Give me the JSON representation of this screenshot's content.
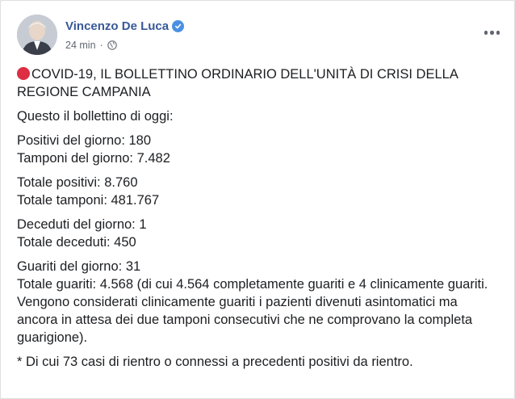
{
  "post": {
    "author": "Vincenzo De Luca",
    "verified": true,
    "time": "24 min",
    "dot_sep": "·",
    "audience_icon": "globe-icon",
    "more_icon": "more-options-icon"
  },
  "content": {
    "headline": "COVID-19, IL BOLLETTINO ORDINARIO DELL'UNITÀ DI CRISI DELLA REGIONE CAMPANIA",
    "intro": "Questo il bollettino di oggi:",
    "daily_positives": "Positivi del giorno: 180",
    "daily_tests": "Tamponi del giorno: 7.482",
    "total_positives": "Totale positivi: 8.760",
    "total_tests": "Totale tamponi: 481.767",
    "daily_deaths": "Deceduti del giorno: 1",
    "total_deaths": "Totale deceduti: 450",
    "daily_recovered": "Guariti del giorno: 31",
    "total_recovered": "Totale guariti: 4.568 (di cui 4.564 completamente guariti e 4 clinicamente guariti. Vengono considerati clinicamente guariti i pazienti divenuti asintomatici ma ancora in attesa dei due tamponi consecutivi che ne comprovano la completa guarigione).",
    "footnote": "* Di cui 73 casi di rientro o connessi a precedenti positivi da rientro."
  },
  "colors": {
    "author": "#385898",
    "text": "#1c1e21",
    "meta": "#616770",
    "red_dot": "#dd2e44",
    "verified": "#4a90e2"
  }
}
